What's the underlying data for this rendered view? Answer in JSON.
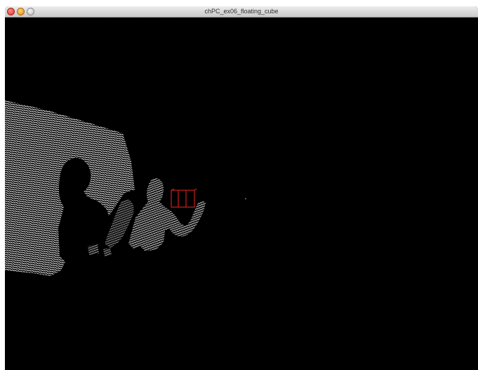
{
  "window": {
    "title": "chPC_ex06_floating_cube",
    "controls": [
      {
        "name": "close",
        "color": "#e0443e"
      },
      {
        "name": "minimize",
        "color": "#e8a327"
      },
      {
        "name": "zoom",
        "color": "#cccccc"
      }
    ]
  },
  "scene": {
    "description_visible": false,
    "background_color": "#000000",
    "point_color": "#ffffff",
    "cube_color": "#cc1f1f"
  }
}
